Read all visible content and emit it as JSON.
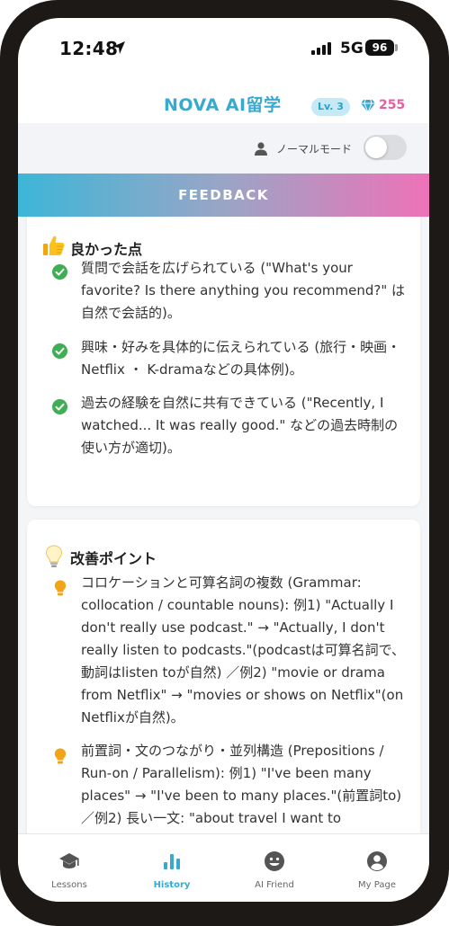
{
  "status_bar": {
    "time": "12:48",
    "network": "5G",
    "battery": "96"
  },
  "header": {
    "title": "NOVA AI留学",
    "level": "Lv. 3",
    "gems": "255"
  },
  "mode": {
    "label": "ノーマルモード",
    "enabled": false
  },
  "banner": {
    "label": "FEEDBACK"
  },
  "good_points": {
    "title": "良かった点",
    "items": [
      "質問で会話を広げられている (\"What's your favorite? Is there anything you recommend?\" は自然で会話的)。",
      "興味・好みを具体的に伝えられている (旅行・映画・Netflix ・ K-dramaなどの具体例)。",
      "過去の経験を自然に共有できている (\"Recently, I watched... It was really good.\" などの過去時制の使い方が適切)。"
    ]
  },
  "improvements": {
    "title": "改善ポイント",
    "items": [
      "コロケーションと可算名詞の複数 (Grammar: collocation / countable nouns): 例1) \"Actually I don't really use podcast.\" → \"Actually, I don't really listen to podcasts.\"(podcastは可算名詞で、動詞はlisten toが自然) ／例2) \"movie or drama from Netflix\" → \"movies or shows on Netflix\"(on Netflixが自然)。",
      "前置詞・文のつながり・並列構造 (Prepositions / Run-on / Parallelism): 例1) \"I've been many places\" → \"I've been to many places.\"(前置詞to) ／例2) 長い一文: \"about travel I want to"
    ]
  },
  "tabs": [
    {
      "label": "Lessons",
      "icon": "graduation-cap-icon",
      "active": false
    },
    {
      "label": "History",
      "icon": "bar-chart-icon",
      "active": true
    },
    {
      "label": "AI Friend",
      "icon": "smiley-icon",
      "active": false
    },
    {
      "label": "My Page",
      "icon": "user-circle-icon",
      "active": false
    }
  ],
  "colors": {
    "accent": "#39a9cf",
    "gem": "#e25fa2",
    "check": "#3fae55",
    "bulb": "#f2a419"
  }
}
